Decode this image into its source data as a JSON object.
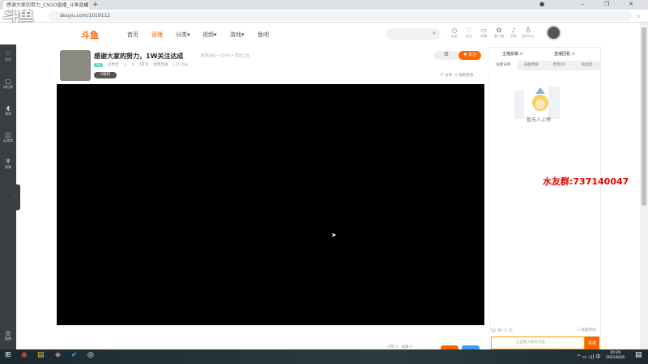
{
  "browser": {
    "tab_title": "感谢大家的努力_CSGO直播_斗鱼直播",
    "url": "douyu.com/1019112",
    "new_tab": "+",
    "close": "×"
  },
  "overlay_logo": "斗鱼",
  "site": {
    "logo": "斗鱼",
    "nav": [
      "首页",
      "直播",
      "分类▾",
      "视频▾",
      "游戏▾",
      "鱼吧"
    ],
    "header_icons": [
      {
        "icon": "clock-icon",
        "glyph": "◷",
        "label": "历史"
      },
      {
        "icon": "heart-icon",
        "glyph": "♡",
        "label": "关注"
      },
      {
        "icon": "camera-icon",
        "glyph": "▭",
        "label": "开播"
      },
      {
        "icon": "gift-icon",
        "glyph": "✿",
        "label": "客户端"
      },
      {
        "icon": "bell-icon",
        "glyph": "♪",
        "label": "消息"
      },
      {
        "icon": "bulb-icon",
        "glyph": "♁",
        "label": "创作中心"
      }
    ]
  },
  "sidebar": {
    "items": [
      {
        "icon": "heart-icon",
        "glyph": "♡",
        "label": "关注"
      },
      {
        "icon": "rank-icon",
        "glyph": "▢",
        "label": "排行榜"
      },
      {
        "icon": "game-icon",
        "glyph": "◖",
        "label": "游戏"
      },
      {
        "icon": "cloud-game-icon",
        "glyph": "◫",
        "label": "云游戏"
      },
      {
        "icon": "trophy-icon",
        "glyph": "♆",
        "label": "赛事"
      }
    ],
    "bottom": {
      "label": "客服",
      "glyph": "◎"
    }
  },
  "room": {
    "title": "感谢大家的努力，1W关注达成",
    "breadcrumb": "网游竞技 • CSGO • 帮助上首",
    "tag": "LV",
    "streamer": "武秀佳",
    "heat": "0",
    "fans": "4友邻",
    "follow_note": "哈哈直播",
    "weight": "171.2kg",
    "level": "V弱鸡",
    "follow_btn": "♥ 关注",
    "share": "分享",
    "report": "福利签到",
    "like": "点赞 0",
    "collect": "收藏 0"
  },
  "panel": {
    "top_left": "主播投稿 >",
    "top_right": "直播回看 >",
    "tabs": [
      "贡献日榜",
      "贡献周榜",
      "贵宾(0)",
      "粉丝团"
    ],
    "empty": "暂无人上榜",
    "block_effects": "屏蔽特效",
    "chat_placeholder": "这里输入聊天内容",
    "send": "发送"
  },
  "watermark": "水友群:737140047",
  "taskbar": {
    "time": "20:29",
    "date": "2021/8/26"
  }
}
